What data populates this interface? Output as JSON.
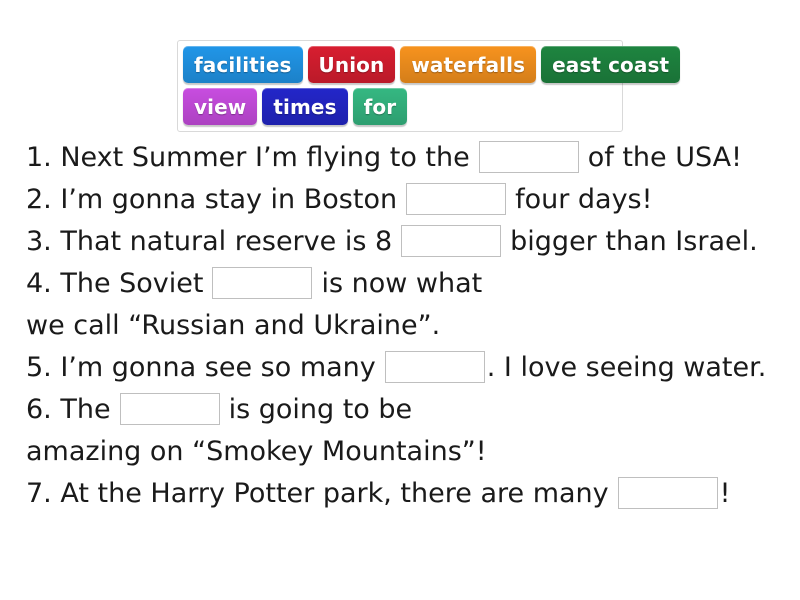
{
  "word_bank": {
    "rows": [
      [
        {
          "label": "facilities",
          "color": "#2196e8"
        },
        {
          "label": "Union",
          "color": "#d81e30"
        },
        {
          "label": "waterfalls",
          "color": "#f7931e"
        },
        {
          "label": "east coast",
          "color": "#1e8540"
        }
      ],
      [
        {
          "label": "view",
          "color": "#c84de0"
        },
        {
          "label": "times",
          "color": "#2326c9"
        },
        {
          "label": "for",
          "color": "#35b882"
        }
      ]
    ]
  },
  "sentences": [
    {
      "number": "1.",
      "before": " Next Summer I’m flying to the",
      "after": "of the USA!",
      "blank": true
    },
    {
      "number": "2.",
      "before": " I’m gonna stay in Boston",
      "after": "four days!",
      "blank": true
    },
    {
      "number": "3.",
      "before": " That natural reserve is 8",
      "after": "bigger than Israel.",
      "blank": true
    },
    {
      "number": "4.",
      "before": " The Soviet",
      "after": "is now what",
      "blank": true
    },
    {
      "number": "",
      "before": "we call “Russian and Ukraine”.",
      "after": "",
      "blank": false
    },
    {
      "number": "5.",
      "before": " I’m gonna see so many",
      "after": ". I love seeing water.",
      "blank": true
    },
    {
      "number": "6.",
      "before": " The",
      "after": "is going to be",
      "blank": true
    },
    {
      "number": "",
      "before": "amazing on “Smokey Mountains”!",
      "after": "",
      "blank": false
    },
    {
      "number": "7.",
      "before": " At the Harry Potter park, there are many",
      "after": "!",
      "blank": true
    }
  ],
  "style": {
    "page_background": "#ffffff",
    "text_color": "#1a1a1a",
    "blank_border": "#bfbfbf",
    "bank_border": "#d9d9d9"
  }
}
